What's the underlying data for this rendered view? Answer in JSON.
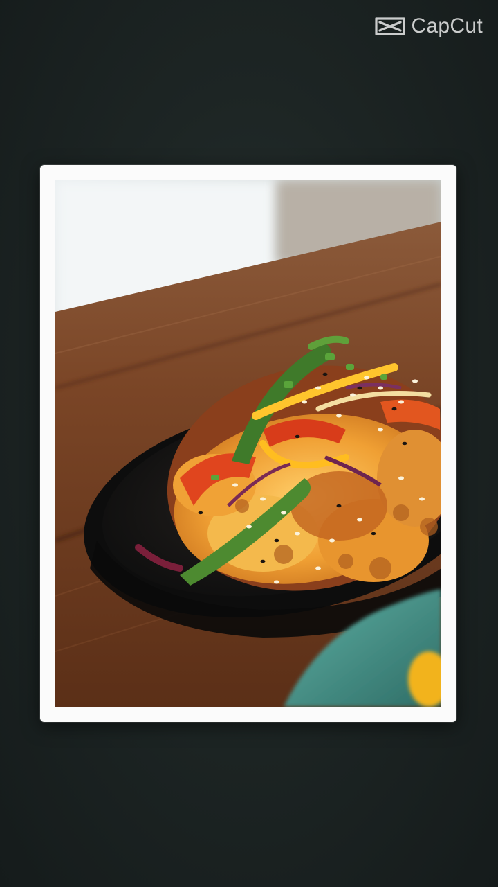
{
  "watermark": {
    "brand": "CapCut",
    "icon": "capcut-logo-icon"
  },
  "photo": {
    "subject": "food-bowl-photo",
    "frame_color": "#fbfbfb"
  },
  "colors": {
    "background": "#1d2524",
    "frame": "#fbfbfb",
    "table_wood": "#7a4526",
    "bowl": "#161616",
    "sauce": "#f3a33a",
    "pepper_green": "#3f7a2a",
    "teal_bowl": "#3e8c83"
  }
}
